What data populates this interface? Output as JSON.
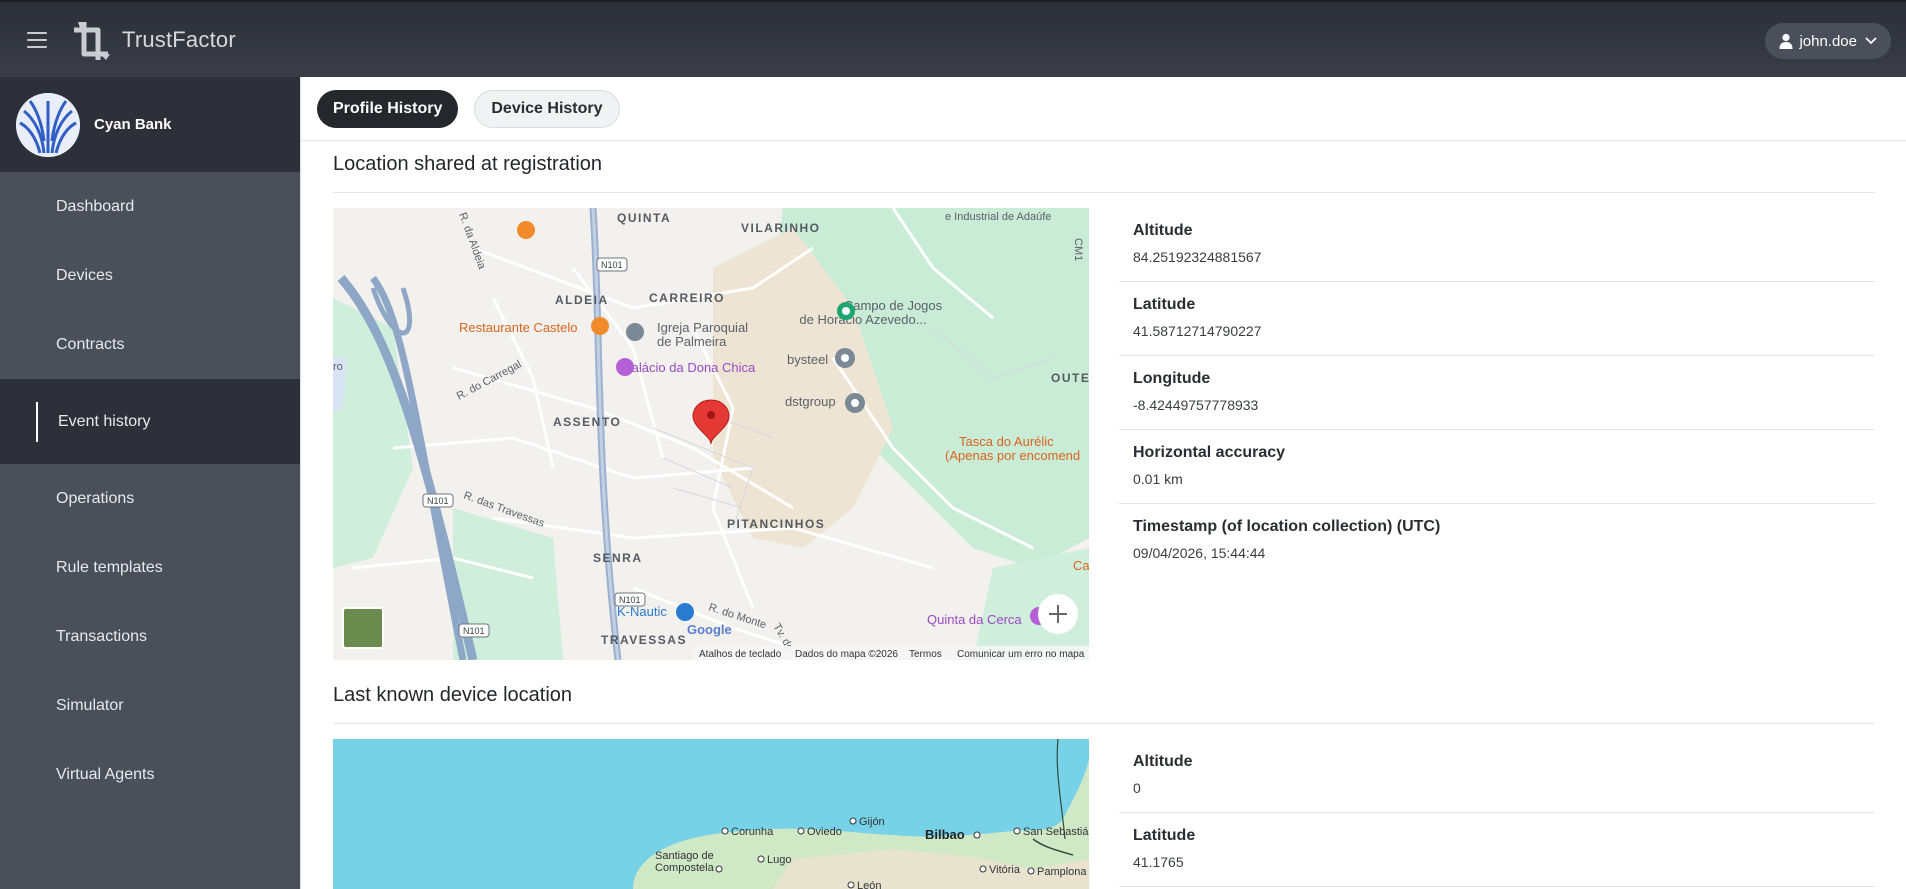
{
  "header": {
    "app_name": "TrustFactor",
    "user": "john.doe"
  },
  "sidebar": {
    "org_name": "Cyan Bank",
    "items": [
      {
        "label": "Dashboard"
      },
      {
        "label": "Devices"
      },
      {
        "label": "Contracts"
      },
      {
        "label": "Event history"
      },
      {
        "label": "Operations"
      },
      {
        "label": "Rule templates"
      },
      {
        "label": "Transactions"
      },
      {
        "label": "Simulator"
      },
      {
        "label": "Virtual Agents"
      }
    ],
    "active_item": "Event history"
  },
  "tabs": [
    {
      "label": "Profile History"
    },
    {
      "label": "Device History"
    }
  ],
  "registration": {
    "title": "Location shared at registration",
    "fields": [
      {
        "label": "Altitude",
        "value": "84.25192324881567"
      },
      {
        "label": "Latitude",
        "value": "41.58712714790227"
      },
      {
        "label": "Longitude",
        "value": "-8.42449757778933"
      },
      {
        "label": "Horizontal accuracy",
        "value": "0.01 km"
      },
      {
        "label": "Timestamp (of location collection) (UTC)",
        "value": "09/04/2026, 15:44:44"
      }
    ],
    "map": {
      "places": {
        "quinta": "QUINTA",
        "vilarinho": "VILARINHO",
        "industrial": "e Industrial de Adaúfe",
        "aldeia": "ALDEIA",
        "carreiro": "CARREIRO",
        "restaurante": "Restaurante Castelo",
        "igreja1": "Igreja Paroquial",
        "igreja2": "de Palmeira",
        "campo1": "Campo de Jogos",
        "campo2": "de Horácio Azevedo...",
        "palacio": "Palácio da Dona Chica",
        "bysteel": "bysteel",
        "dstgroup": "dstgroup",
        "outeiro": "OUTE",
        "assento": "ASSENTO",
        "carregal": "R. do Carregal",
        "tasca1": "Tasca do Aurélic",
        "tasca2": "(Apenas por encomend",
        "pitancinhos": "PITANCINHOS",
        "senra": "SENRA",
        "travessas_rd": "R. das Travessas",
        "knautic": "K-Nautic",
        "rmonte": "R. do Monte",
        "travessas": "TRAVESSAS",
        "quinta_cerca": "Quinta da Cerca",
        "ca": "Ca",
        "raldeia": "R. da Aldeia",
        "ro": "ro",
        "tvde": "Tv. de",
        "cm": "CM1"
      },
      "roads": {
        "n101": "N101"
      },
      "footer": {
        "shortcuts": "Atalhos de teclado",
        "data": "Dados do mapa ©2026",
        "terms": "Termos",
        "report": "Comunicar um erro no mapa"
      },
      "google": "Google"
    }
  },
  "last_known": {
    "title": "Last known device location",
    "fields": [
      {
        "label": "Altitude",
        "value": "0"
      },
      {
        "label": "Latitude",
        "value": "41.1765"
      }
    ],
    "map": {
      "places": {
        "corunha": "Corunha",
        "oviedo": "Oviedo",
        "gijon": "Gijón",
        "bilbao": "Bilbao",
        "sansebastian": "San Sebastián",
        "santiago1": "Santiago de",
        "santiago2": "Compostela",
        "lugo": "Lugo",
        "vitoria": "Vitória",
        "pamplona": "Pamplona",
        "leon": "León"
      }
    }
  }
}
